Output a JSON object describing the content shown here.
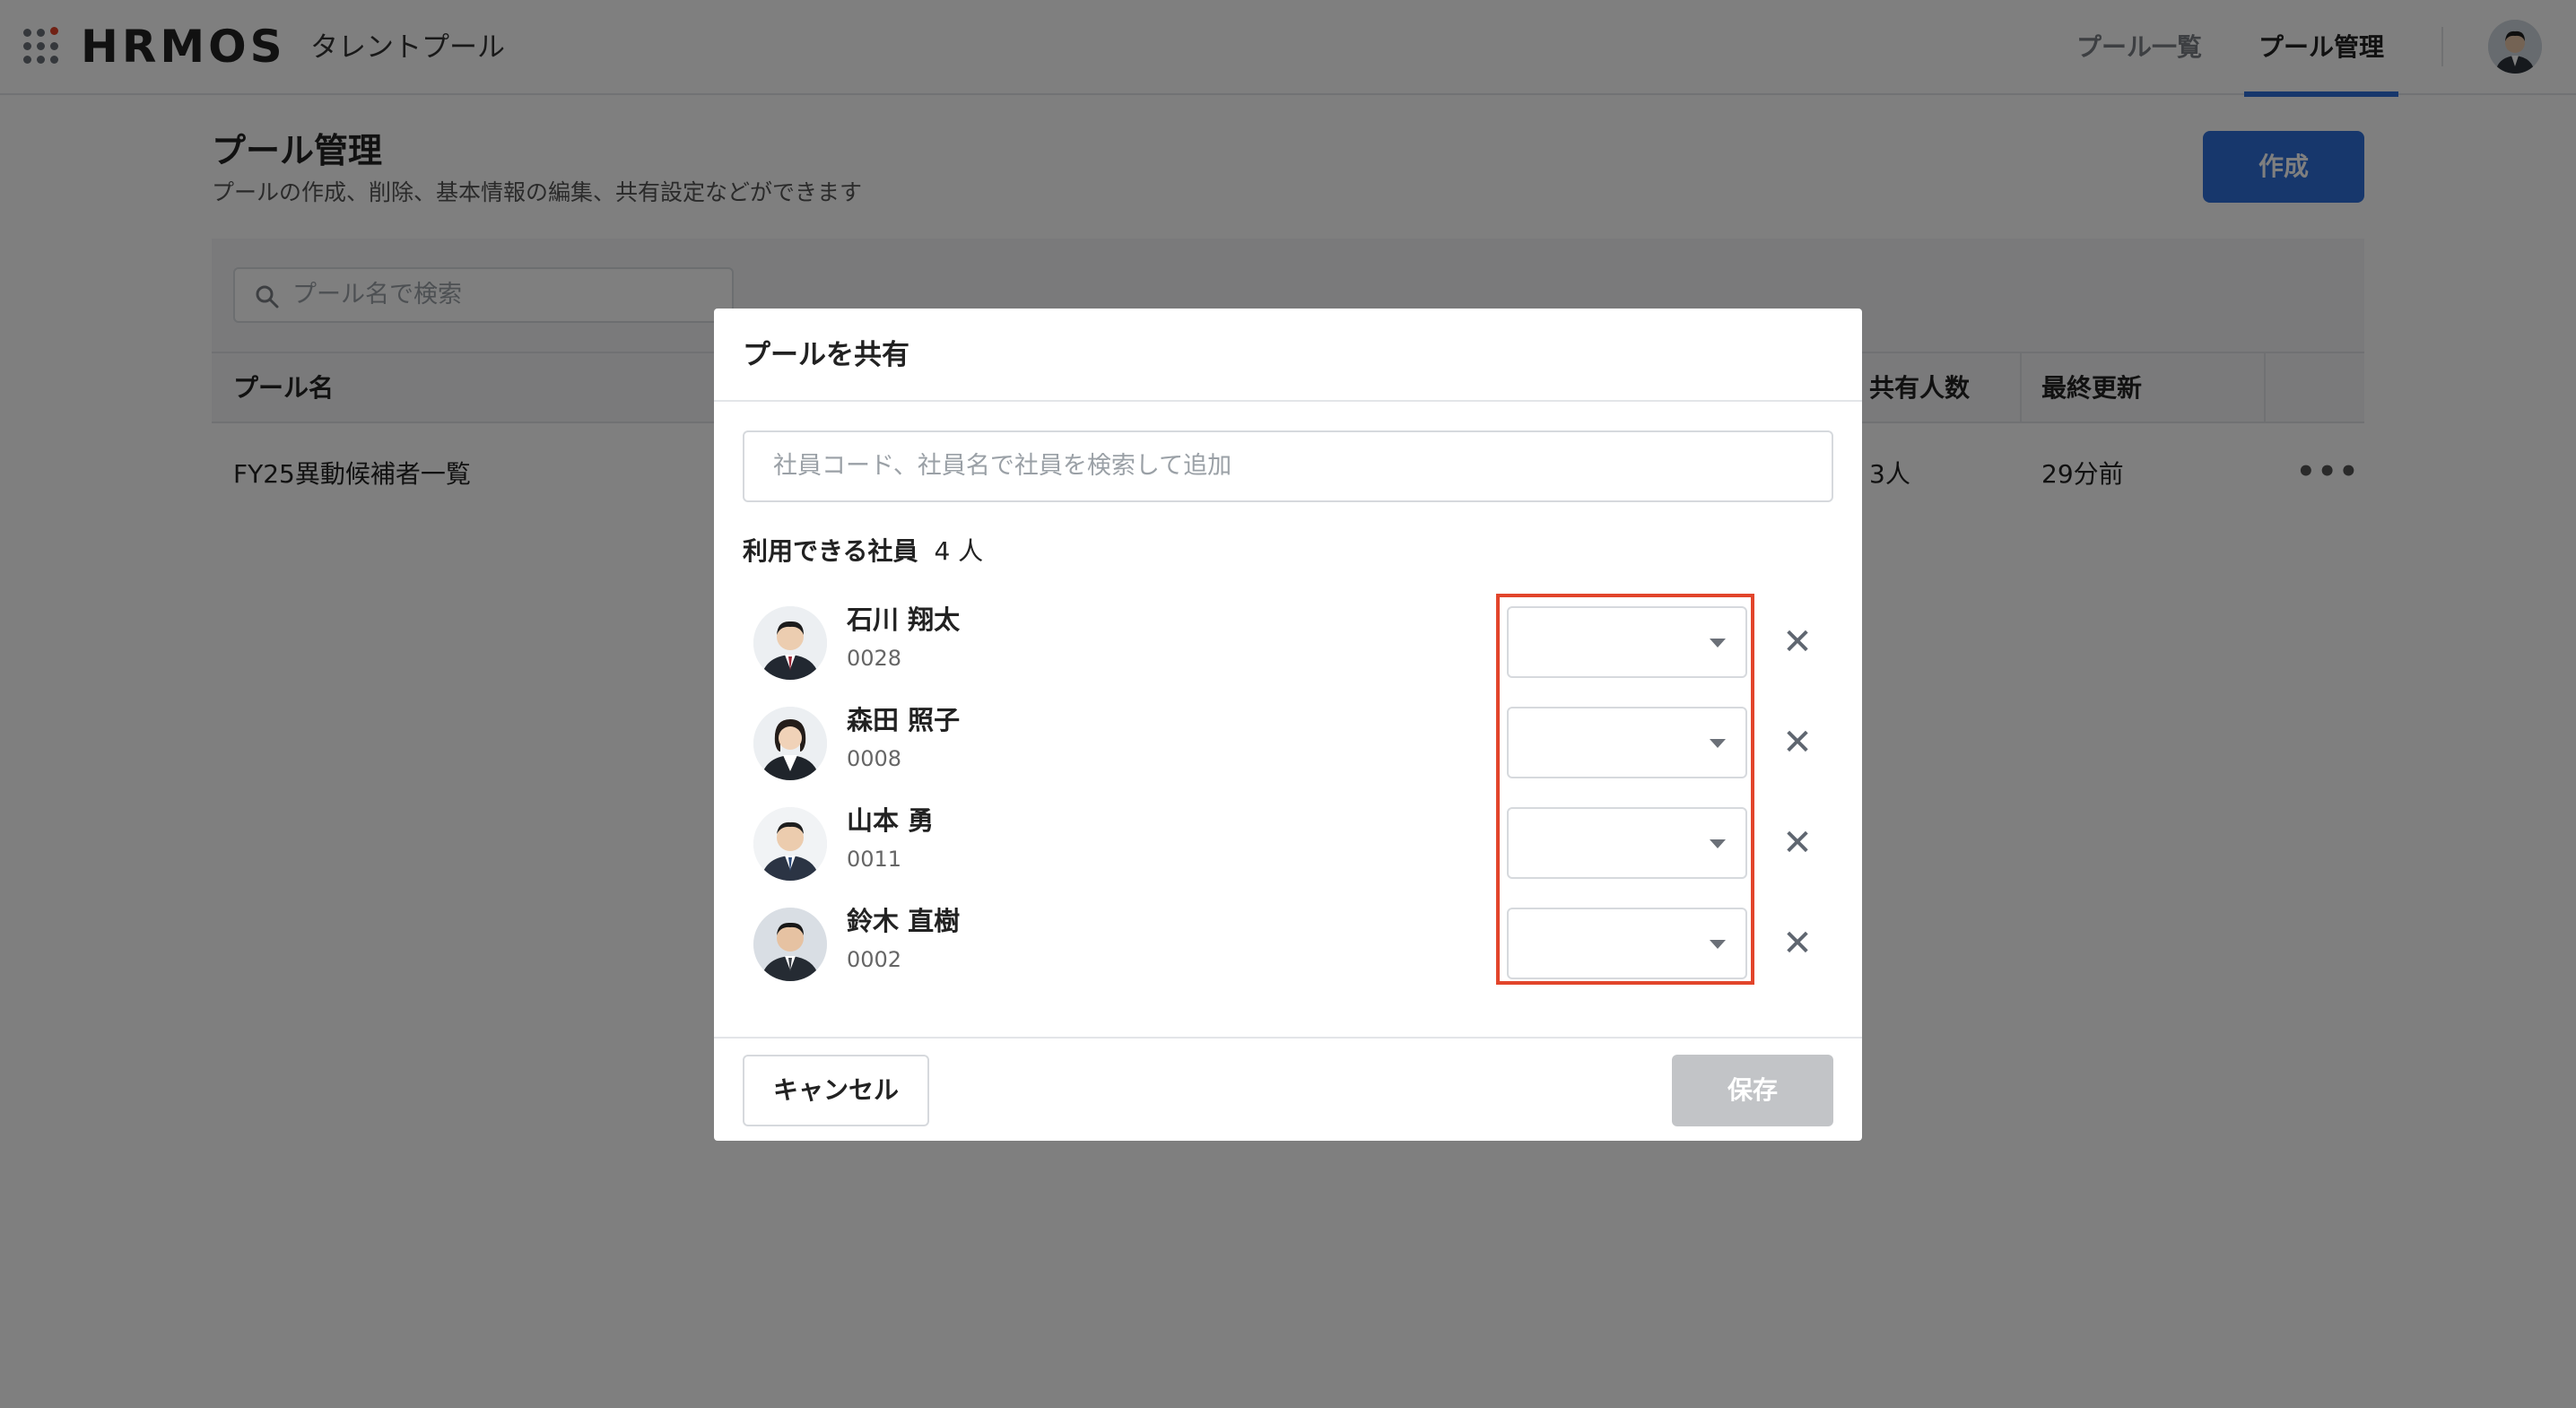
{
  "header": {
    "logo": "HRMOS",
    "app_name": "タレントプール",
    "nav": [
      {
        "label": "プール一覧",
        "active": false
      },
      {
        "label": "プール管理",
        "active": true
      }
    ]
  },
  "page": {
    "title": "プール管理",
    "subtitle": "プールの作成、削除、基本情報の編集、共有設定などができます",
    "create_label": "作成",
    "search_placeholder": "プール名で検索",
    "table": {
      "columns": [
        "プール名",
        "共有人数",
        "最終更新"
      ],
      "rows": [
        {
          "name": "FY25異動候補者一覧",
          "shared": "3人",
          "updated": "29分前"
        }
      ]
    }
  },
  "modal": {
    "title": "プールを共有",
    "search_placeholder": "社員コード、社員名で社員を検索して追加",
    "available_label": "利用できる社員",
    "available_count": "4 人",
    "employees": [
      {
        "name": "石川 翔太",
        "code": "0028",
        "role": ""
      },
      {
        "name": "森田 照子",
        "code": "0008",
        "role": ""
      },
      {
        "name": "山本 勇",
        "code": "0011",
        "role": ""
      },
      {
        "name": "鈴木 直樹",
        "code": "0002",
        "role": ""
      }
    ],
    "cancel_label": "キャンセル",
    "save_label": "保存",
    "save_enabled": false
  },
  "colors": {
    "primary": "#2f6fd8",
    "highlight": "#e2452b",
    "disabled": "#c2c4c7"
  }
}
